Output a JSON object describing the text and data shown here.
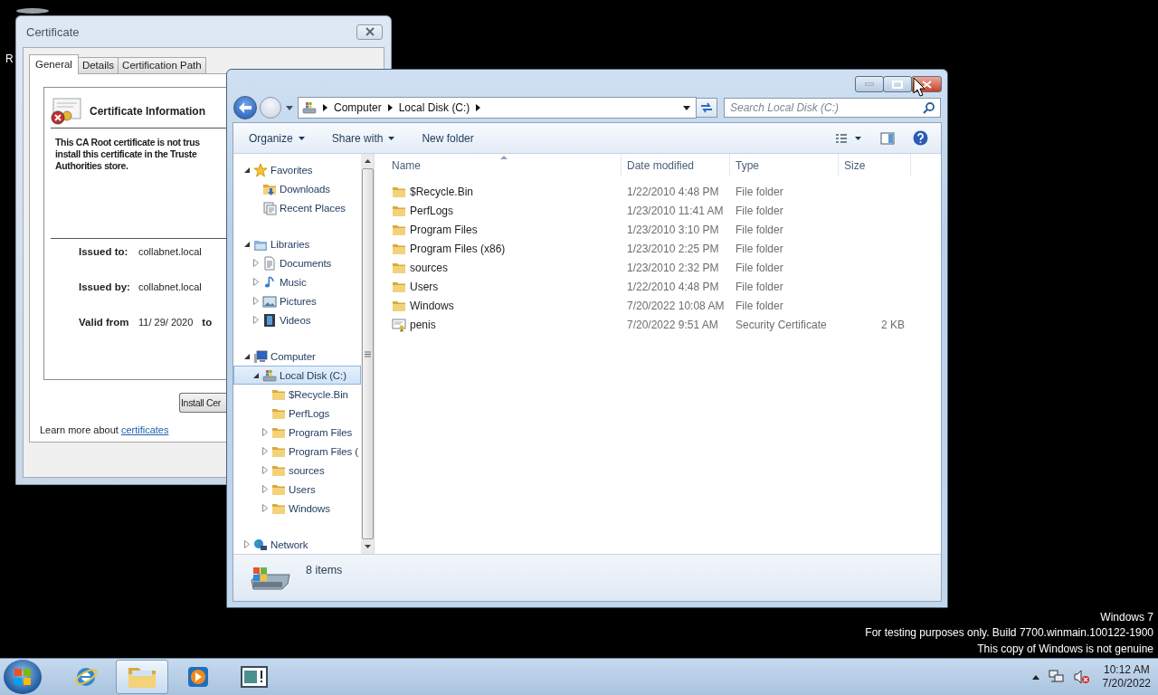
{
  "desktop": {
    "label": "R",
    "watermark": [
      "Windows 7",
      "For testing purposes only. Build 7700.winmain.100122-1900",
      "This copy of Windows is not genuine"
    ]
  },
  "certificate_window": {
    "title": "Certificate",
    "tabs": [
      {
        "label": "General",
        "selected": true
      },
      {
        "label": "Details",
        "selected": false
      },
      {
        "label": "Certification Path",
        "selected": false
      }
    ],
    "heading": "Certificate Information",
    "message_lines": [
      "This CA Root certificate is not trus",
      "install this certificate in the Truste",
      "Authorities store."
    ],
    "fields": [
      {
        "label": "Issued to:",
        "value": "collabnet.local"
      },
      {
        "label": "Issued by:",
        "value": "collabnet.local"
      }
    ],
    "validity": {
      "label": "Valid from",
      "date": "11/ 29/ 2020",
      "to": "to"
    },
    "install_button": "Install Cer",
    "learn_more": {
      "text": "Learn more about",
      "link": "certificates"
    }
  },
  "explorer": {
    "breadcrumb": [
      "Computer",
      "Local Disk (C:)"
    ],
    "search": {
      "placeholder": "Search Local Disk (C:)"
    },
    "commands": [
      {
        "label": "Organize",
        "dropdown": true
      },
      {
        "label": "Share with",
        "dropdown": true
      },
      {
        "label": "New folder",
        "dropdown": false
      }
    ],
    "tree": [
      {
        "label": "Favorites",
        "kind": "star",
        "expanded": true,
        "selected": false,
        "children": [
          {
            "label": "Downloads",
            "kind": "downloads",
            "selected": false
          },
          {
            "label": "Recent Places",
            "kind": "recent",
            "selected": false
          }
        ]
      },
      {
        "label": "Libraries",
        "kind": "library",
        "expanded": true,
        "selected": false,
        "children": [
          {
            "label": "Documents",
            "kind": "document",
            "expanded": false,
            "selected": false
          },
          {
            "label": "Music",
            "kind": "music",
            "expanded": false,
            "selected": false
          },
          {
            "label": "Pictures",
            "kind": "picture",
            "expanded": false,
            "selected": false
          },
          {
            "label": "Videos",
            "kind": "video",
            "expanded": false,
            "selected": false
          }
        ]
      },
      {
        "label": "Computer",
        "kind": "computer",
        "expanded": true,
        "selected": false,
        "children": [
          {
            "label": "Local Disk (C:)",
            "kind": "drive",
            "expanded": true,
            "selected": true,
            "children": [
              {
                "label": "$Recycle.Bin",
                "kind": "folder",
                "selected": false
              },
              {
                "label": "PerfLogs",
                "kind": "folder",
                "selected": false
              },
              {
                "label": "Program Files",
                "kind": "folder",
                "expanded": false,
                "selected": false
              },
              {
                "label": "Program Files (",
                "kind": "folder",
                "expanded": false,
                "selected": false
              },
              {
                "label": "sources",
                "kind": "folder",
                "expanded": false,
                "selected": false
              },
              {
                "label": "Users",
                "kind": "folder",
                "expanded": false,
                "selected": false
              },
              {
                "label": "Windows",
                "kind": "folder",
                "expanded": false,
                "selected": false
              }
            ]
          }
        ]
      },
      {
        "label": "Network",
        "kind": "network",
        "expanded": false,
        "selected": false
      }
    ],
    "columns": [
      "Name",
      "Date modified",
      "Type",
      "Size"
    ],
    "files": [
      {
        "name": "$Recycle.Bin",
        "kind": "folder",
        "date": "1/22/2010 4:48 PM",
        "type": "File folder"
      },
      {
        "name": "PerfLogs",
        "kind": "folder",
        "date": "1/23/2010 11:41 AM",
        "type": "File folder"
      },
      {
        "name": "Program Files",
        "kind": "folder",
        "date": "1/23/2010 3:10 PM",
        "type": "File folder"
      },
      {
        "name": "Program Files (x86)",
        "kind": "folder",
        "date": "1/23/2010 2:25 PM",
        "type": "File folder"
      },
      {
        "name": "sources",
        "kind": "folder",
        "date": "1/23/2010 2:32 PM",
        "type": "File folder"
      },
      {
        "name": "Users",
        "kind": "folder",
        "date": "1/22/2010 4:48 PM",
        "type": "File folder"
      },
      {
        "name": "Windows",
        "kind": "folder",
        "date": "7/20/2022 10:08 AM",
        "type": "File folder"
      },
      {
        "name": "penis",
        "kind": "certificate",
        "date": "7/20/2022 9:51 AM",
        "type": "Security Certificate",
        "size": "2 KB"
      }
    ],
    "status": "8 items"
  },
  "taskbar": {
    "apps": [
      {
        "kind": "browser",
        "active": false
      },
      {
        "kind": "folder",
        "active": true
      },
      {
        "kind": "player",
        "active": false
      },
      {
        "kind": "window",
        "active": false
      }
    ],
    "clock": {
      "time": "10:12 AM",
      "date": "7/20/2022"
    }
  }
}
